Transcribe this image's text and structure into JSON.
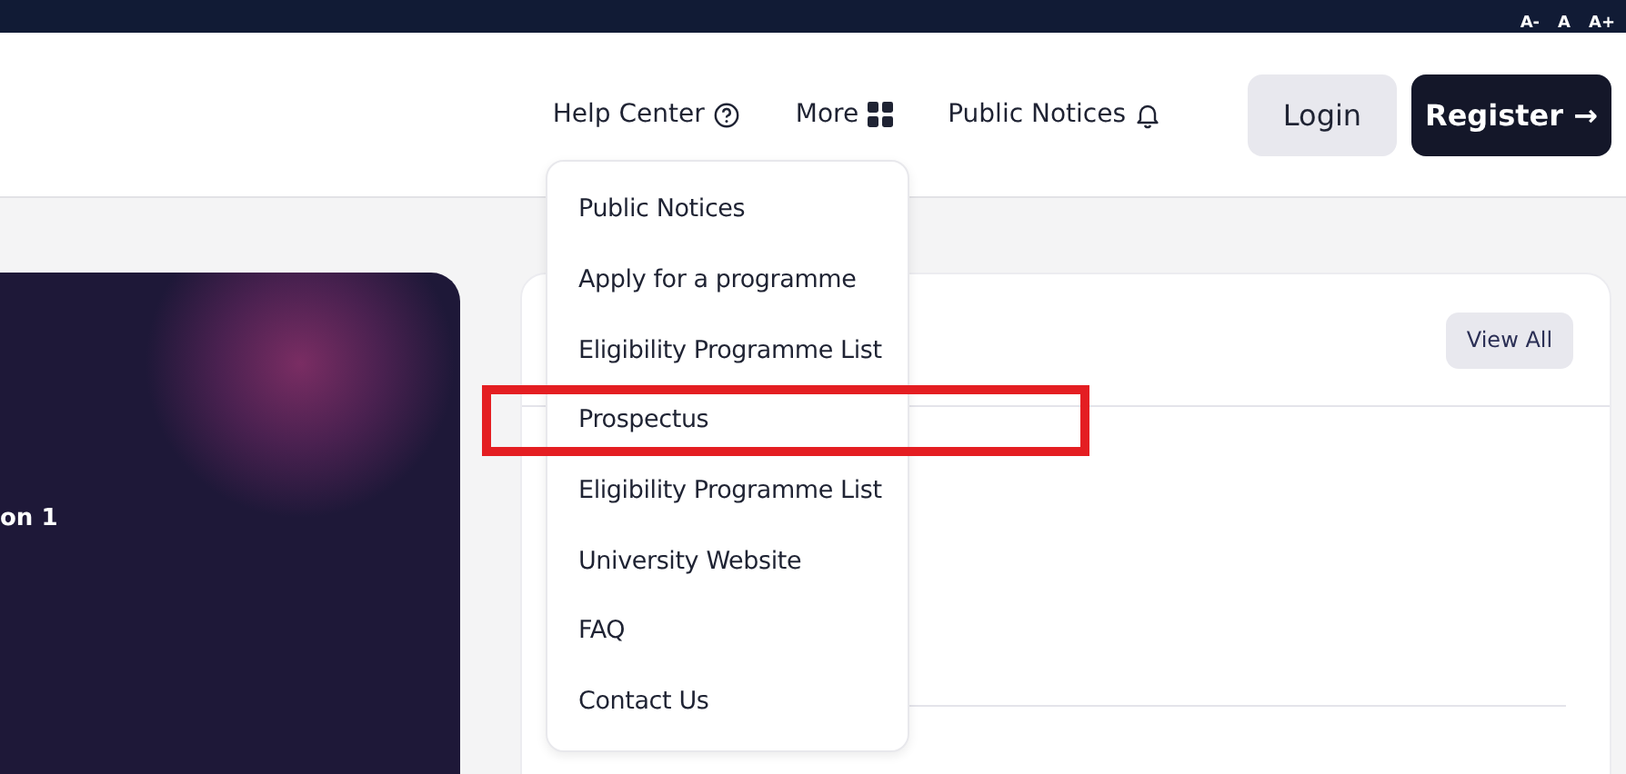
{
  "top_bar": {
    "font_size_controls": [
      "A-",
      "A",
      "A+"
    ]
  },
  "nav": {
    "links": [
      {
        "label": "Help Center",
        "kind": "help"
      },
      {
        "label": "More",
        "kind": "grid"
      },
      {
        "label": "Public Notices",
        "kind": "bell"
      }
    ],
    "login": "Login",
    "register": "Register →"
  },
  "more_menu": {
    "items": [
      {
        "label": "Public Notices",
        "highlighted": false
      },
      {
        "label": "Apply for a programme",
        "highlighted": false
      },
      {
        "label": "Eligibility Programme List",
        "highlighted": false
      },
      {
        "label": "Prospectus",
        "highlighted": true
      },
      {
        "label": "Eligibility Programme List",
        "highlighted": false
      },
      {
        "label": "University Website",
        "highlighted": false
      },
      {
        "label": "FAQ",
        "highlighted": false
      },
      {
        "label": "Contact Us",
        "highlighted": false
      }
    ]
  },
  "hero_card": {
    "text": "on 1"
  },
  "notices_card": {
    "view_all": "View All"
  }
}
